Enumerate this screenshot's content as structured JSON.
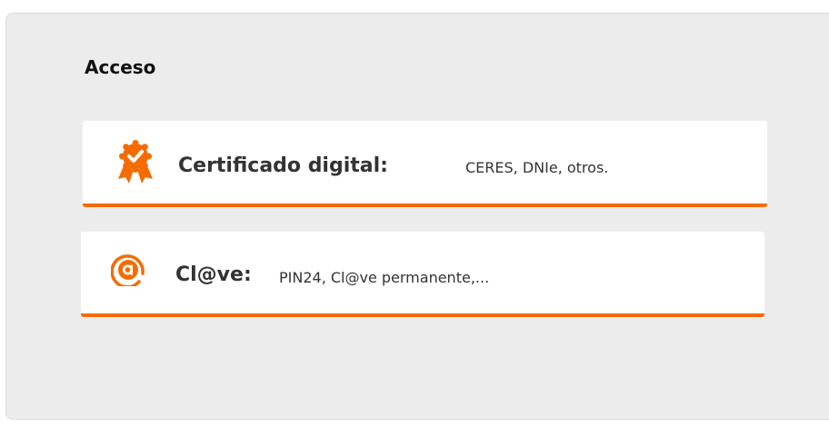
{
  "section": {
    "title": "Acceso"
  },
  "options": [
    {
      "icon": "award-badge-icon",
      "label": "Certificado digital:",
      "description": "CERES, DNIe, otros."
    },
    {
      "icon": "at-sign-icon",
      "label": "Cl@ve:",
      "description": "PIN24, Cl@ve permanente,..."
    }
  ],
  "colors": {
    "accent": "#f46c00",
    "panel_background": "#ececec",
    "card_background": "#ffffff",
    "text": "#333333"
  }
}
